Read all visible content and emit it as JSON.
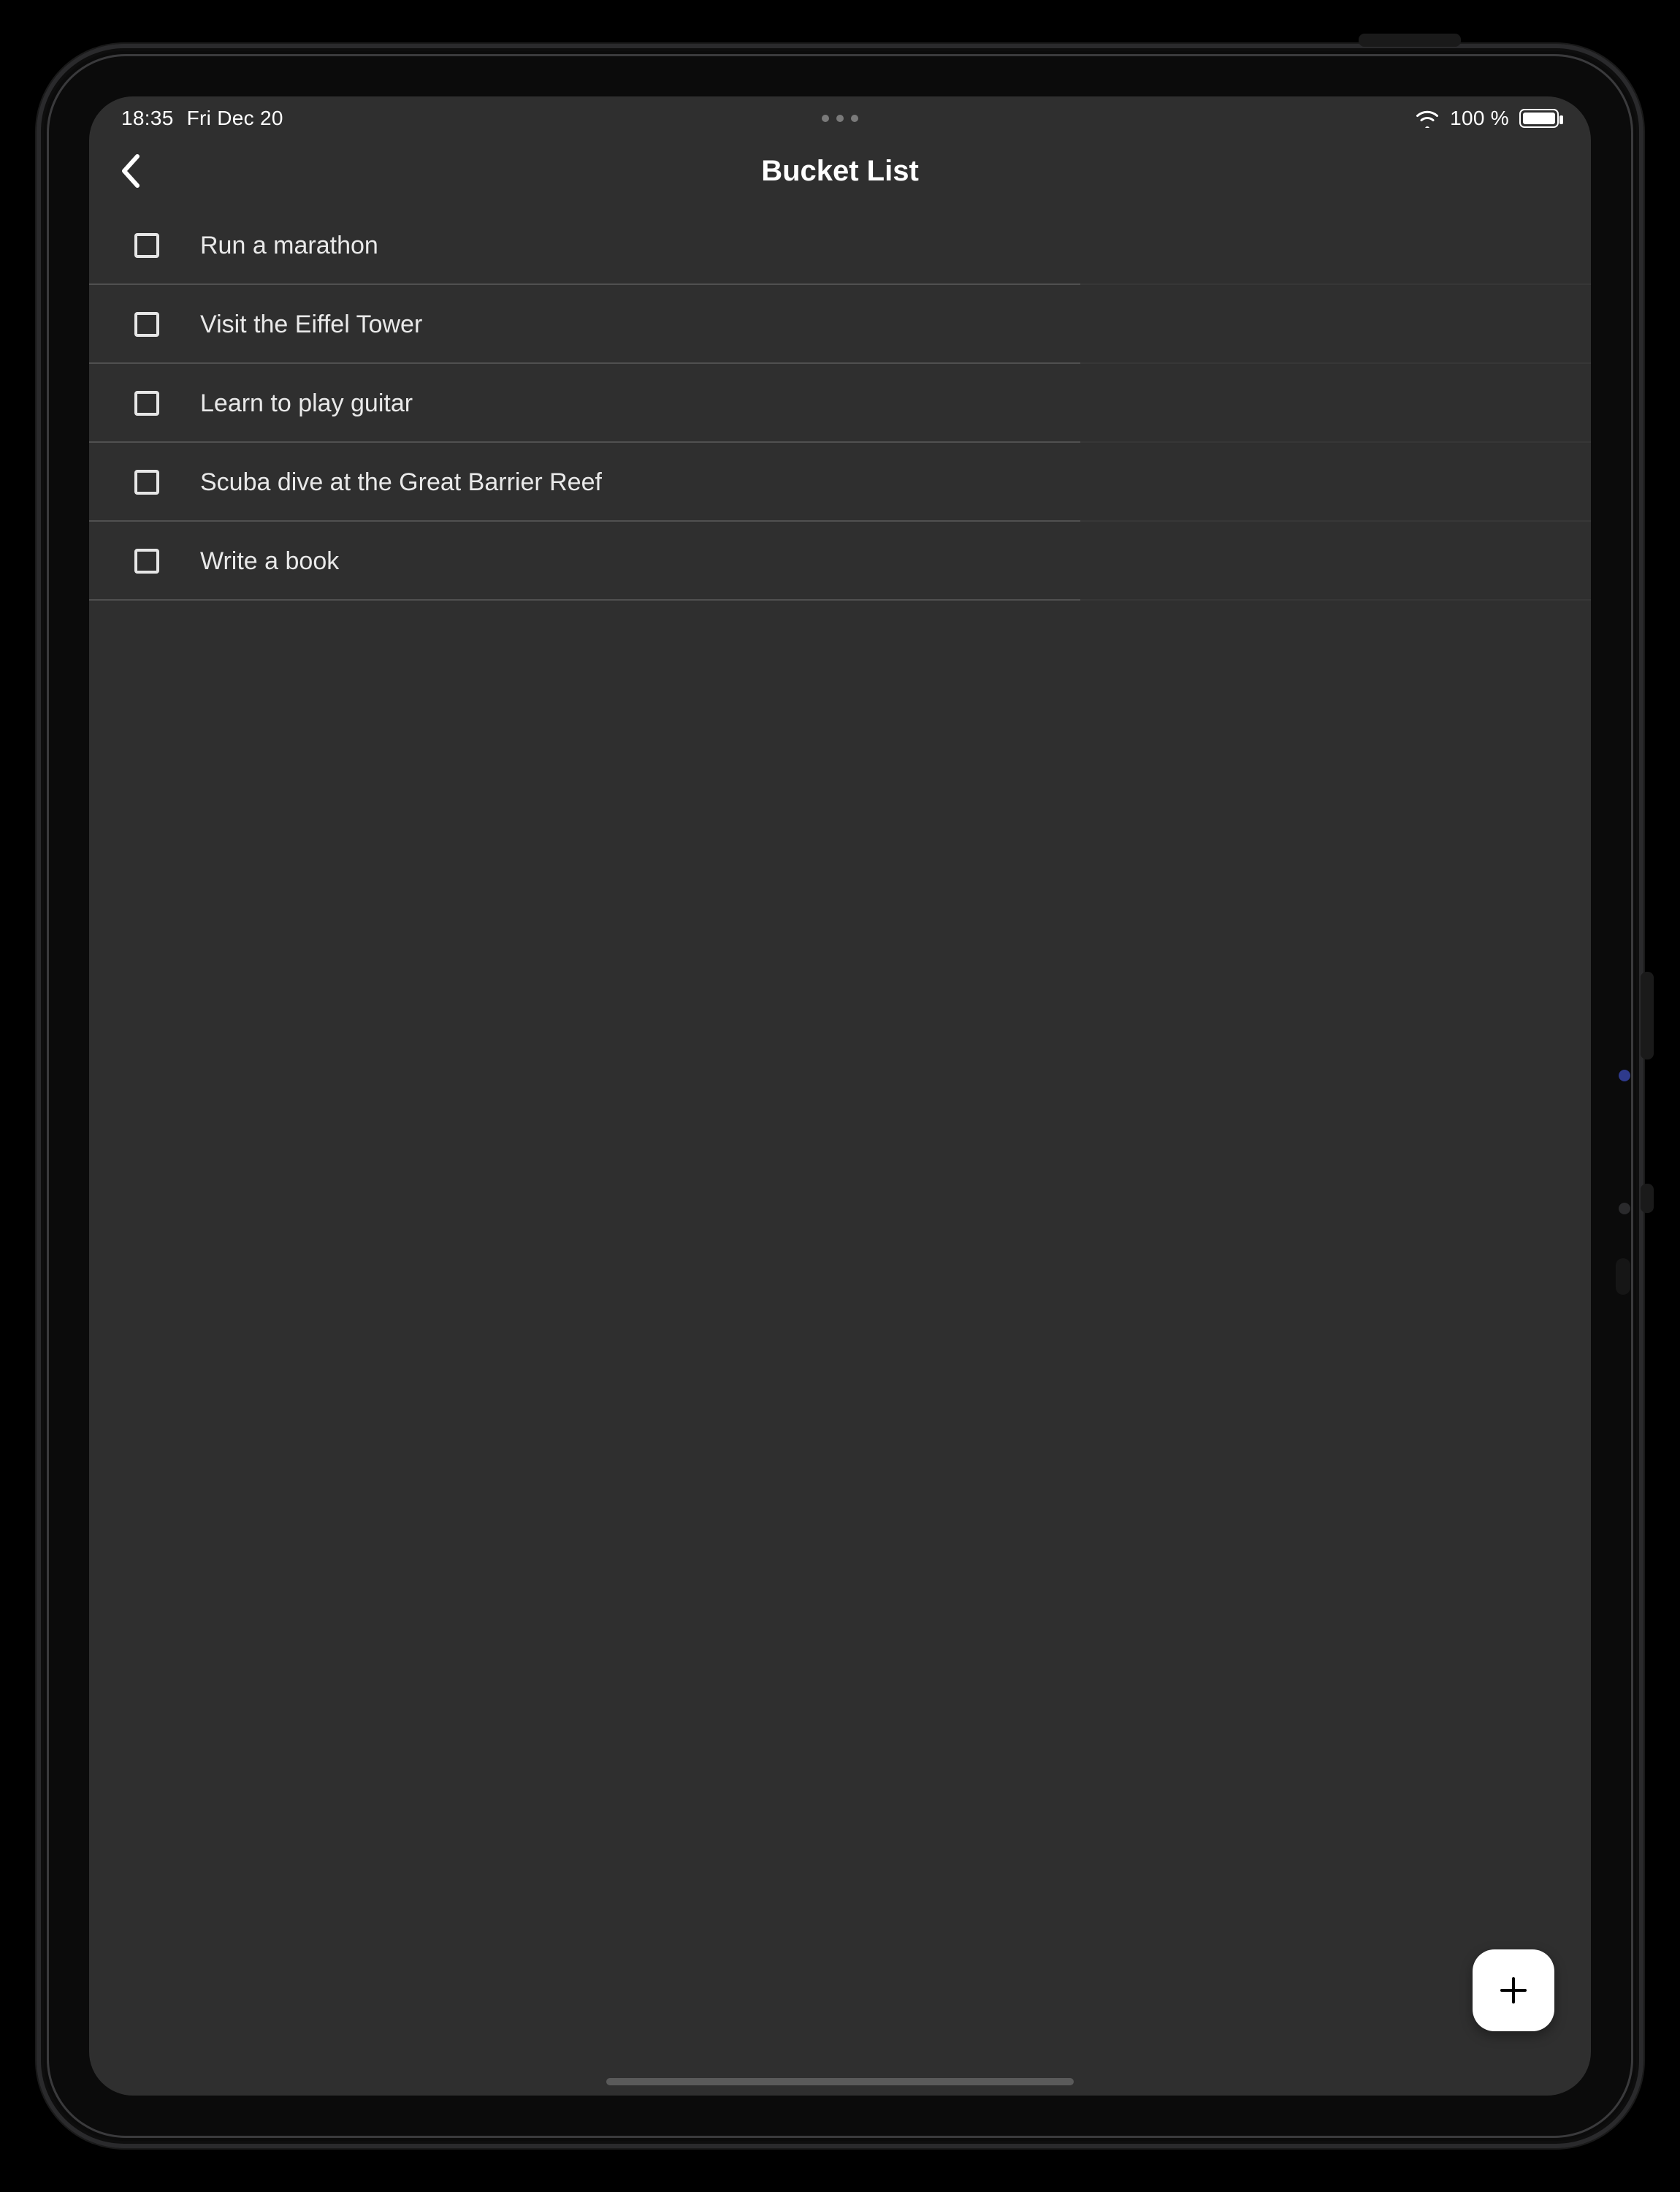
{
  "status": {
    "time": "18:35",
    "date": "Fri Dec 20",
    "battery_text": "100 %"
  },
  "header": {
    "title": "Bucket List"
  },
  "items": [
    {
      "label": "Run a marathon"
    },
    {
      "label": "Visit the Eiffel Tower"
    },
    {
      "label": "Learn to play guitar"
    },
    {
      "label": "Scuba dive at the Great Barrier Reef"
    },
    {
      "label": "Write a book"
    }
  ]
}
